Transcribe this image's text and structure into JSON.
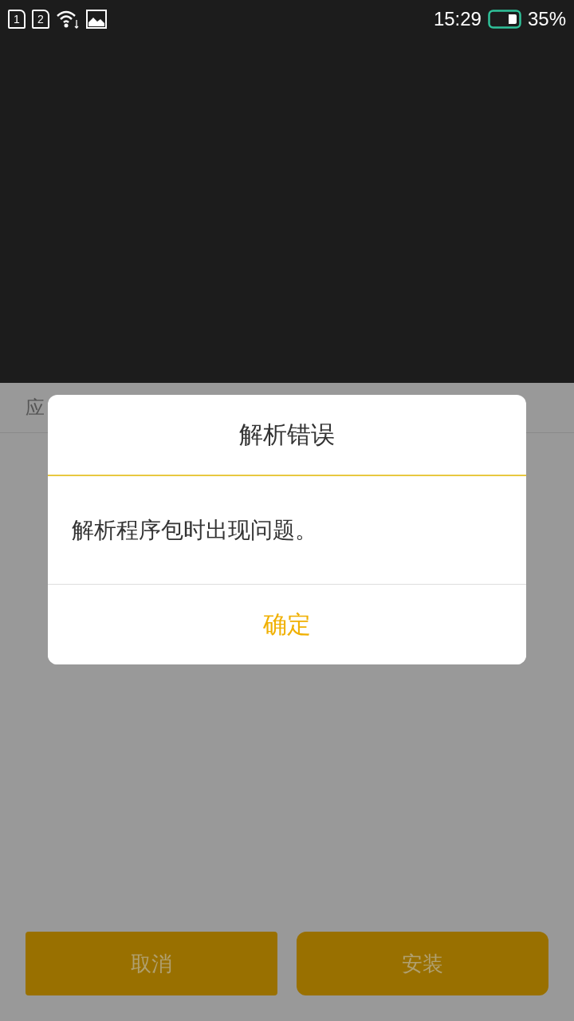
{
  "status_bar": {
    "sim_slots": [
      "1",
      "2"
    ],
    "time": "15:29",
    "battery_percent": "35%"
  },
  "sheet": {
    "header_label": "应",
    "buttons": [
      {
        "label": "取消"
      },
      {
        "label": "安装"
      }
    ]
  },
  "dialog": {
    "title": "解析错误",
    "message": "解析程序包时出现问题。",
    "confirm": "确定"
  }
}
